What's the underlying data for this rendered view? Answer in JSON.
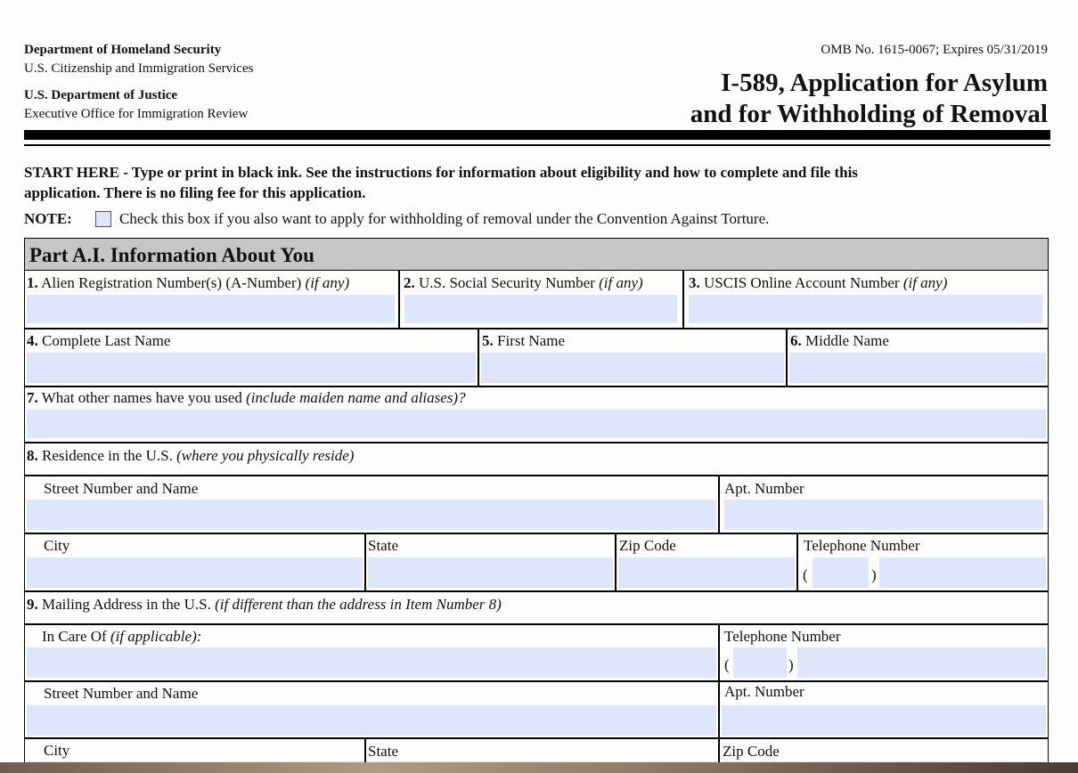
{
  "header": {
    "agency1": "Department of Homeland Security",
    "agency1_sub": "U.S. Citizenship and Immigration Services",
    "agency2": "U.S. Department of Justice",
    "agency2_sub": "Executive Office for Immigration Review",
    "omb": "OMB No. 1615-0067; Expires 05/31/2019",
    "title_line1": "I-589, Application for Asylum",
    "title_line2": "and for Withholding of Removal"
  },
  "instructions": {
    "line1": "START HERE - Type or print in black ink.  See the instructions for information about eligibility and how to complete and file this",
    "line2": "application.  There is no filing fee for this application.",
    "note_label": "NOTE:",
    "note_text": "Check this box if you also want to apply for withholding of removal under the Convention Against Torture."
  },
  "part": {
    "title": "Part A.I.  Information About You"
  },
  "fields": {
    "f1_num": "1.",
    "f1_label": "Alien Registration Number(s) (A-Number)",
    "f1_note": "(if any)",
    "f2_num": "2.",
    "f2_label": "U.S. Social Security Number",
    "f2_note": "(if any)",
    "f3_num": "3.",
    "f3_label": "USCIS Online Account Number",
    "f3_note": "(if any)",
    "f4_num": "4.",
    "f4_label": "Complete Last Name",
    "f5_num": "5.",
    "f5_label": "First Name",
    "f6_num": "6.",
    "f6_label": "Middle Name",
    "f7_num": "7.",
    "f7_label": "What other names have you used",
    "f7_note": "(include maiden name and aliases)?",
    "f8_num": "8.",
    "f8_label": "Residence in the U.S.",
    "f8_note": "(where you physically reside)",
    "street": "Street Number and Name",
    "apt": "Apt. Number",
    "city": "City",
    "state": "State",
    "zip": "Zip Code",
    "telephone": "Telephone Number",
    "paren_open": "(",
    "paren_close": ")",
    "f9_num": "9.",
    "f9_label": "Mailing Address in the U.S.",
    "f9_note": "(if different than the address in Item Number 8)",
    "in_care_of": "In Care Of",
    "in_care_of_note": "(if applicable):"
  },
  "colors": {
    "field_fill": "#dfe6fb",
    "part_bar": "#c6c6c6"
  }
}
